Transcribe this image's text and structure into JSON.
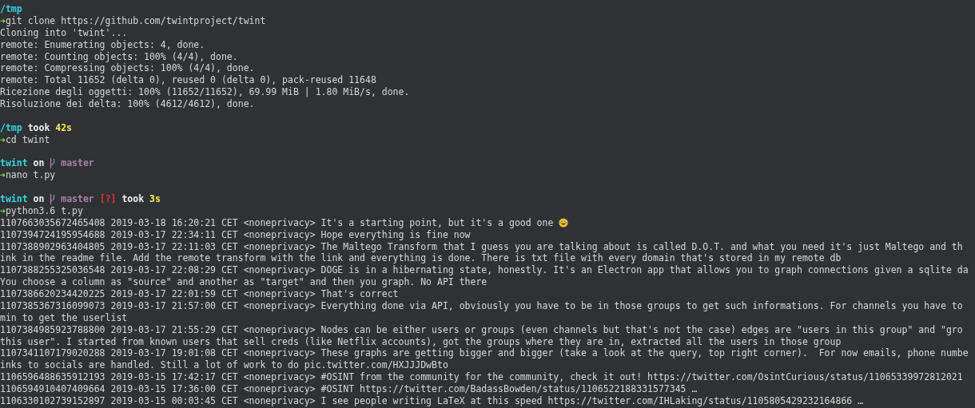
{
  "terminal": {
    "lines": [
      {
        "kind": "prompt",
        "dir": "/tmp"
      },
      {
        "kind": "command",
        "arrow": "➜",
        "text": "git clone https://github.com/twintproject/twint"
      },
      {
        "kind": "output",
        "text": "Cloning into 'twint'..."
      },
      {
        "kind": "output",
        "text": "remote: Enumerating objects: 4, done."
      },
      {
        "kind": "output",
        "text": "remote: Counting objects: 100% (4/4), done."
      },
      {
        "kind": "output",
        "text": "remote: Compressing objects: 100% (4/4), done."
      },
      {
        "kind": "output",
        "text": "remote: Total 11652 (delta 0), reused 0 (delta 0), pack-reused 11648"
      },
      {
        "kind": "output",
        "text": "Ricezione degli oggetti: 100% (11652/11652), 69.99 MiB | 1.80 MiB/s, done."
      },
      {
        "kind": "output",
        "text": "Risoluzione dei delta: 100% (4612/4612), done."
      },
      {
        "kind": "blank"
      },
      {
        "kind": "prompt",
        "dir": "/tmp",
        "took": "took",
        "duration": "42s"
      },
      {
        "kind": "command",
        "arrow": "➜",
        "text": "cd twint"
      },
      {
        "kind": "blank"
      },
      {
        "kind": "prompt",
        "dir": "twint",
        "on": "on",
        "branch": "master"
      },
      {
        "kind": "command",
        "arrow": "➜",
        "text": "nano t.py"
      },
      {
        "kind": "blank"
      },
      {
        "kind": "prompt",
        "dir": "twint",
        "on": "on",
        "branch": "master",
        "status": "[?]",
        "took": "took",
        "duration": "3s"
      },
      {
        "kind": "command",
        "arrow": "➜",
        "text": "python3.6 t.py"
      },
      {
        "kind": "output_emoji",
        "text": "1107663035672465408 2019-03-18 16:20:21 CET <noneprivacy> It's a starting point, but it's a good one"
      },
      {
        "kind": "output",
        "text": "1107394724195954688 2019-03-17 22:34:11 CET <noneprivacy> Hope everything is fine now"
      },
      {
        "kind": "output",
        "text": "1107388902963404805 2019-03-17 22:11:03 CET <noneprivacy> The Maltego Transform that I guess you are talking about is called D.O.T. and what you need it's just Maltego and th"
      },
      {
        "kind": "output",
        "text": "ink in the readme file. Add the remote transform with the link and everything is done. There is txt file with every domain that's stored in my remote db"
      },
      {
        "kind": "output",
        "text": "1107388255325036548 2019-03-17 22:08:29 CET <noneprivacy> DOGE is in a hibernating state, honestly. It's an Electron app that allows you to graph connections given a sqlite da"
      },
      {
        "kind": "output",
        "text": "You choose a column as \"source\" and another as \"target\" and then you graph. No API there"
      },
      {
        "kind": "output",
        "text": "1107386620234420225 2019-03-17 22:01:59 CET <noneprivacy> That's correct"
      },
      {
        "kind": "output",
        "text": "1107385367316099073 2019-03-17 21:57:00 CET <noneprivacy> Everything done via API, obviously you have to be in those groups to get such informations. For channels you have to"
      },
      {
        "kind": "output",
        "text": "min to get the userlist"
      },
      {
        "kind": "output",
        "text": "1107384985923788800 2019-03-17 21:55:29 CET <noneprivacy> Nodes can be either users or groups (even channels but that's not the case) edges are \"users in this group\" and \"gro"
      },
      {
        "kind": "output",
        "text": "this user\". I started from known users that sell creds (like Netflix accounts), got the groups where they are in, extracted all the users in those group"
      },
      {
        "kind": "output",
        "text": "1107341107179020288 2019-03-17 19:01:08 CET <noneprivacy> These graphs are getting bigger and bigger (take a look at the query, top right corner).  For now emails, phone numbe"
      },
      {
        "kind": "output",
        "text": "inks to socials are handled. Still a lot of work to do pic.twitter.com/HXJJJDwBto"
      },
      {
        "kind": "output",
        "text": "1106596488635912193 2019-03-15 17:42:17 CET <noneprivacy> #OSINT from the community for the community, check it out! https://twitter.com/OsintCurious/status/11065339972812021"
      },
      {
        "kind": "output",
        "text": "1106594910407409664 2019-03-15 17:36:00 CET <noneprivacy> #OSINT https://twitter.com/BadassBowden/status/1106522188331577345 …"
      },
      {
        "kind": "output",
        "text": "1106330102739152897 2019-03-15 00:03:45 CET <noneprivacy> I see people writing LaTeX at this speed https://twitter.com/IHLaking/status/1105805429232164866 …"
      }
    ]
  }
}
